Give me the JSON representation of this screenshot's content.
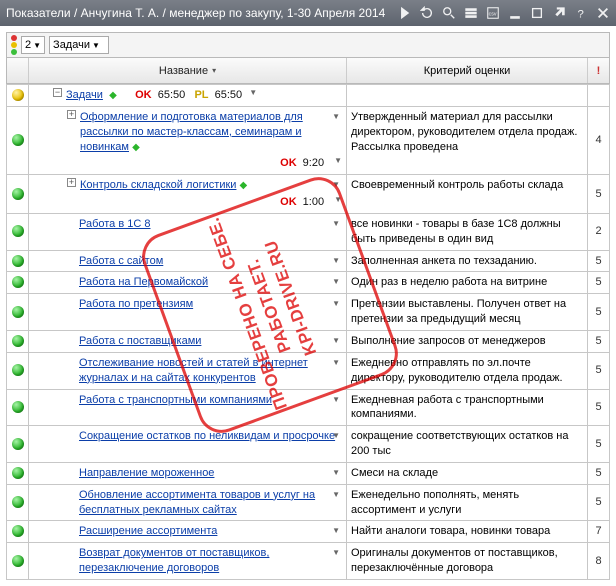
{
  "titlebar": {
    "text": "Показатели / Анчугина Т. А. / менеджер по закупу, 1-30 Апреля 2014"
  },
  "toolbar": {
    "num": "2",
    "filter": "Задачи"
  },
  "headers": {
    "name": "Название",
    "criteria": "Критерий оценки",
    "exclaim": "!"
  },
  "summary": {
    "label": "Задачи",
    "ok_label": "OK",
    "ok_val": "65:50",
    "pl_label": "PL",
    "pl_val": "65:50"
  },
  "rows": [
    {
      "status": "green",
      "indent": 34,
      "tree": "plus",
      "name": "Оформление и подготовка материалов для рассылки по мастер-классам, семинарам и новинкам",
      "ok": "9:20",
      "criteria": "Утвержденный материал для рассылки директором, руководителем отдела продаж. Рассылка проведена",
      "pts": "4"
    },
    {
      "status": "green",
      "indent": 34,
      "tree": "plus",
      "name": "Контроль складской логистики",
      "ok": "1:00",
      "criteria": "Своевременный контроль работы склада",
      "pts": "5"
    },
    {
      "status": "green",
      "indent": 46,
      "name": "Работа в 1С 8",
      "criteria": "все новинки - товары в базе 1С8 должны быть приведены в один вид",
      "pts": "2"
    },
    {
      "status": "green",
      "indent": 46,
      "name": "Работа с сайтом",
      "criteria": "Заполненная анкета по техзаданию.",
      "pts": "5"
    },
    {
      "status": "green",
      "indent": 46,
      "name": "Работа на Первомайской",
      "criteria": "Один раз в неделю работа на витрине",
      "pts": "5"
    },
    {
      "status": "green",
      "indent": 46,
      "name": "Работа по претензиям",
      "criteria": "Претензии выставлены. Получен ответ на претензии за предыдущий месяц",
      "pts": "5"
    },
    {
      "status": "green",
      "indent": 46,
      "name": "Работа с поставщиками",
      "criteria": "Выполнение запросов от менеджеров",
      "pts": "5"
    },
    {
      "status": "green",
      "indent": 46,
      "name": "Отслеживание новостей и статей в интернет журналах и на сайтах конкурентов",
      "criteria": "Ежедневно отправлять по эл.почте директору, руководителю отдела продаж.",
      "pts": "5"
    },
    {
      "status": "green",
      "indent": 46,
      "name": "Работа с транспортными компаниями",
      "criteria": "Ежедневная работа с транспортными компаниями.",
      "pts": "5"
    },
    {
      "status": "green",
      "indent": 46,
      "name": "Сокращение остатков по неликвидам и просрочке",
      "criteria": "сокращение соответствующих остатков на 200 тыс",
      "pts": "5"
    },
    {
      "status": "green",
      "indent": 46,
      "name": "Направление мороженное",
      "criteria": "Смеси на складе",
      "pts": "5"
    },
    {
      "status": "green",
      "indent": 46,
      "name": "Обновление ассортимента товаров и услуг на бесплатных рекламных сайтах",
      "criteria": "Еженедельно пополнять, менять ассортимент и услуги",
      "pts": "5"
    },
    {
      "status": "green",
      "indent": 46,
      "name": "Расширение ассортимента",
      "criteria": "Найти аналоги товара, новинки товара",
      "pts": "7"
    },
    {
      "status": "green",
      "indent": 46,
      "name": "Возврат документов от поставщиков, перезаключение договоров",
      "criteria": "Оригиналы документов от поставщиков, перезаключённые договора",
      "pts": "8"
    }
  ],
  "watermark": {
    "line1": "ПРОВЕРЕНО НА СЕБЕ.",
    "line2": "РАБОТАЕТ.",
    "line3": "KPI-DRIVE.RU"
  }
}
